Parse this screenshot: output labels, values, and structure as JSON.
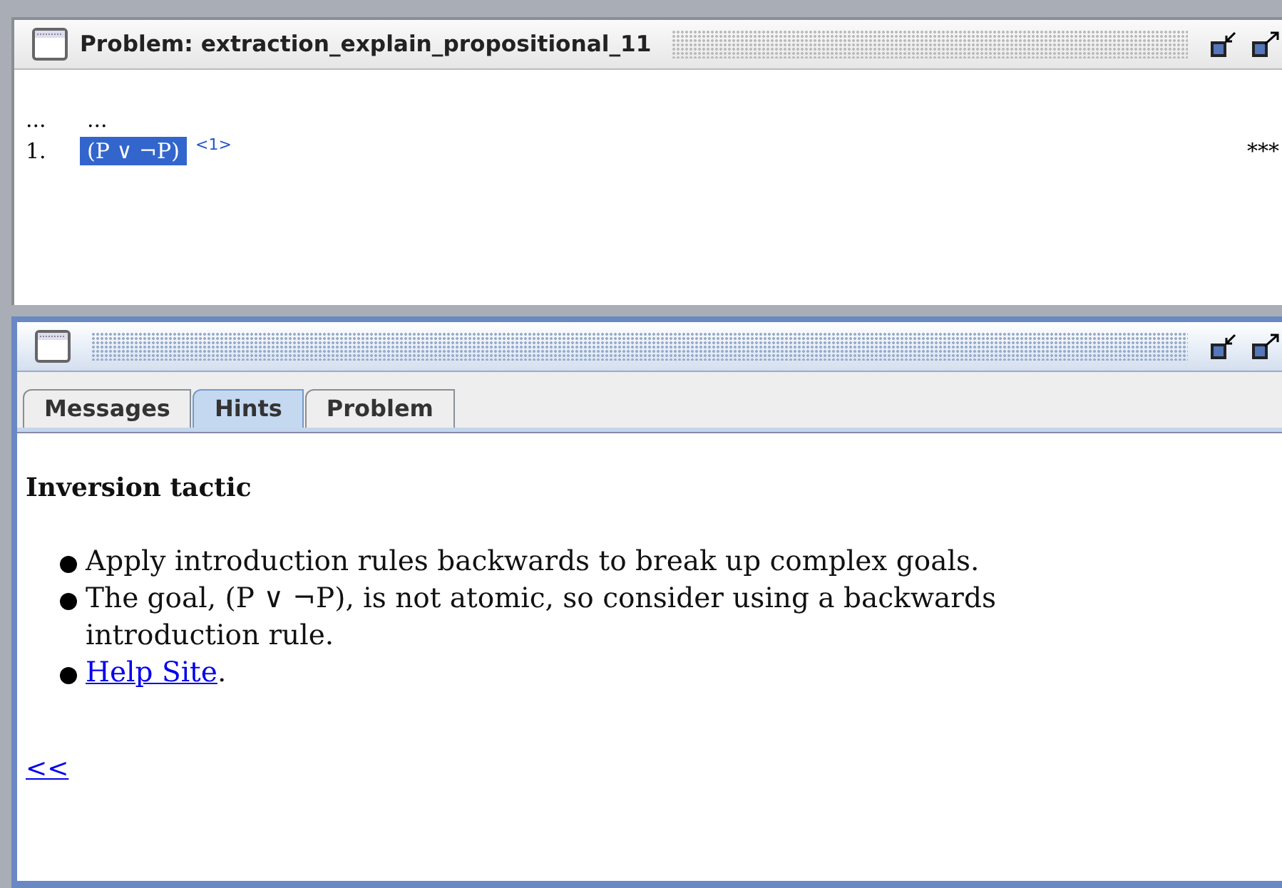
{
  "problem_window": {
    "title": "Problem: extraction_explain_propositional_11",
    "lines": [
      {
        "number": "...",
        "formula": "...",
        "selected": false
      },
      {
        "number": "1.",
        "formula": "(P ∨ ¬P)",
        "selected": true,
        "ref": "<1>",
        "status": "***"
      }
    ]
  },
  "hints_window": {
    "tabs": [
      {
        "label": "Messages",
        "selected": false
      },
      {
        "label": "Hints",
        "selected": true
      },
      {
        "label": "Problem",
        "selected": false
      }
    ],
    "heading": "Inversion tactic",
    "items": [
      {
        "kind": "text",
        "text": "Apply introduction rules backwards to break up complex goals."
      },
      {
        "kind": "text",
        "text": "The goal, (P ∨ ¬P), is not atomic, so consider using a backwards introduction rule."
      },
      {
        "kind": "link",
        "link": "Help Site",
        "text": "."
      }
    ],
    "back_link": "<<"
  }
}
